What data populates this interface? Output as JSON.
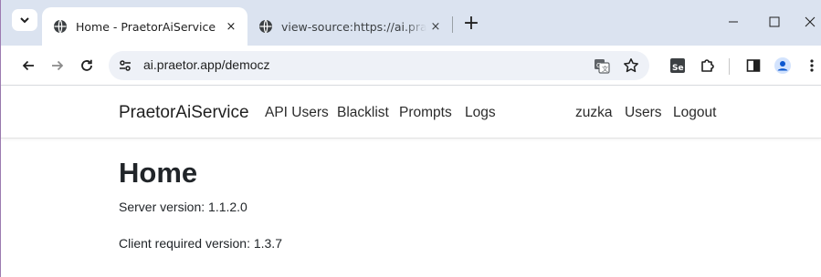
{
  "browser": {
    "tabs": [
      {
        "title": "Home - PraetorAiService",
        "active": true,
        "close_glyph": "×"
      },
      {
        "title": "view-source:https://ai.praetor.ai",
        "active": false,
        "close_glyph": "×"
      }
    ],
    "new_tab_glyph": "+",
    "address_bar": {
      "url": "ai.praetor.app/democz"
    },
    "icons": [
      "tab-list-icon",
      "globe-icon",
      "back-icon",
      "forward-icon",
      "reload-icon",
      "site-info-icon",
      "translate-icon",
      "bookmark-star-icon",
      "selenium-icon",
      "extensions-icon",
      "side-panel-icon",
      "profile-icon",
      "menu-icon",
      "minimize-icon",
      "maximize-icon",
      "close-window-icon"
    ]
  },
  "navbar": {
    "brand": "PraetorAiService",
    "left_links": [
      "API Users",
      "Blacklist",
      "Prompts",
      "Logs"
    ],
    "right_links": [
      "zuzka",
      "Users",
      "Logout"
    ]
  },
  "main": {
    "title": "Home",
    "server_version_text": "Server version: 1.1.2.0",
    "client_version_text": "Client required version: 1.3.7"
  },
  "colors": {
    "tabstrip_bg": "#dbe3f0",
    "omnibox_bg": "#eef1f7",
    "profile_accent": "#0b57d0",
    "text": "#212529"
  }
}
